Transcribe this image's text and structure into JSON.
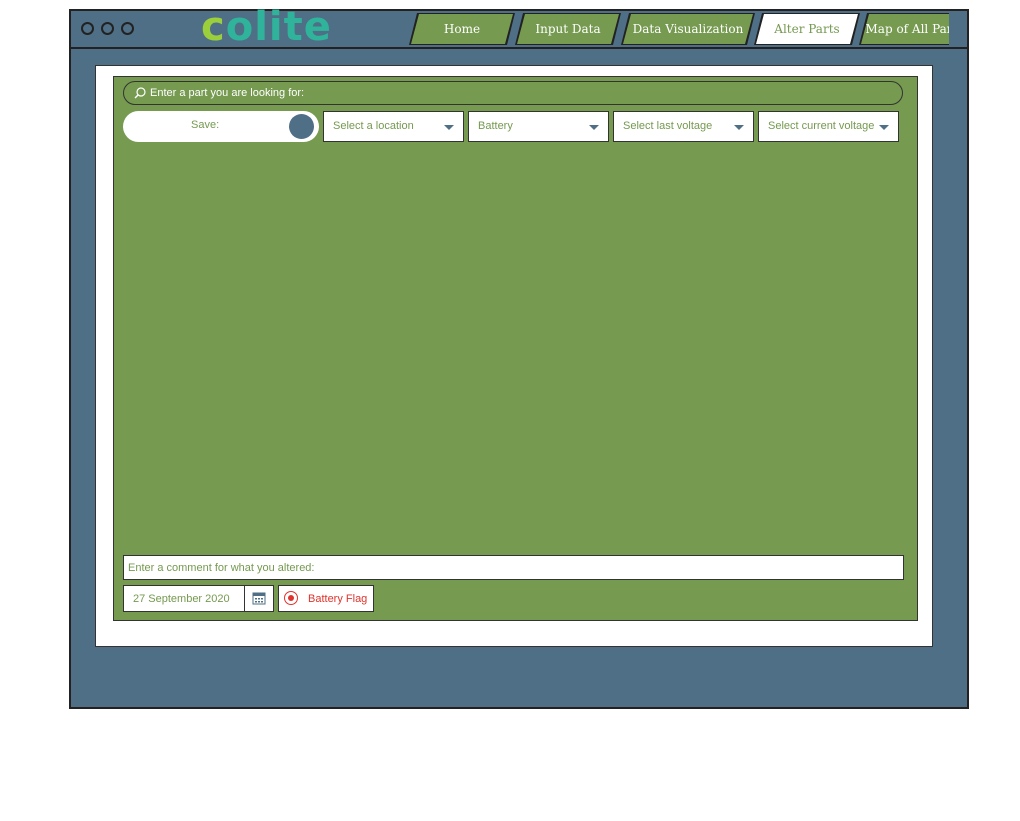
{
  "app": {
    "logo_first": "c",
    "logo_rest": "olite"
  },
  "nav": {
    "tabs": [
      {
        "label": "Home"
      },
      {
        "label": "Input Data"
      },
      {
        "label": "Data Visualization"
      },
      {
        "label": "Alter Parts",
        "active": true
      },
      {
        "label": "Map of All Par"
      }
    ]
  },
  "search": {
    "placeholder": "Enter a part you are looking for:"
  },
  "save_toggle": {
    "label": "Save:"
  },
  "filters": {
    "location": "Select a location",
    "part_type": "Battery",
    "last_voltage": "Select last voltage",
    "current_voltage": "Select current voltage"
  },
  "comment": {
    "placeholder": "Enter a comment for what you altered:"
  },
  "date": {
    "value": "27 September 2020"
  },
  "flag": {
    "label": "Battery Flag"
  },
  "colors": {
    "frame": "#4f6f86",
    "panel_green": "#759a50",
    "flag_red": "#e0332d",
    "logo_lime": "#9ccf3c",
    "logo_teal": "#2fb39a"
  },
  "icons": [
    "search-icon",
    "calendar-icon",
    "chevron-down-icon",
    "radio-selected-icon"
  ]
}
